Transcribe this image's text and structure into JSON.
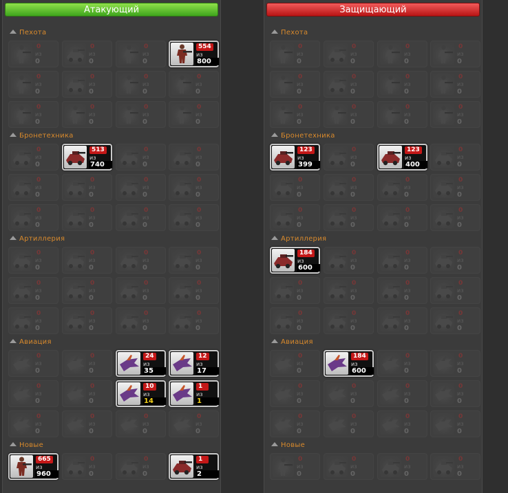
{
  "colors": {
    "attacker": "#3fa51d",
    "defender": "#b81515",
    "section": "#d98a2c",
    "count_badge": "#c41818"
  },
  "sides": [
    {
      "id": "left",
      "title": "Атакующий",
      "theme": "green",
      "sections": [
        {
          "name": "Пехота",
          "cells": [
            {
              "kind": "infantry",
              "count": "0",
              "total": "0"
            },
            {
              "kind": "vehicle",
              "count": "0",
              "total": "0"
            },
            {
              "kind": "infantry",
              "count": "0",
              "total": "0"
            },
            {
              "kind": "infantry",
              "count": "554",
              "total": "800",
              "active": true
            },
            {
              "kind": "infantry",
              "count": "0",
              "total": "0"
            },
            {
              "kind": "vehicle",
              "count": "0",
              "total": "0"
            },
            {
              "kind": "infantry",
              "count": "0",
              "total": "0"
            },
            {
              "kind": "infantry",
              "count": "0",
              "total": "0"
            },
            {
              "kind": "infantry",
              "count": "0",
              "total": "0"
            },
            {
              "kind": "infantry",
              "count": "0",
              "total": "0"
            },
            {
              "kind": "infantry",
              "count": "0",
              "total": "0"
            },
            {
              "kind": "infantry",
              "count": "0",
              "total": "0"
            }
          ]
        },
        {
          "name": "Бронетехника",
          "cells": [
            {
              "kind": "vehicle",
              "count": "0",
              "total": "0"
            },
            {
              "kind": "vehicle",
              "count": "513",
              "total": "740",
              "active": true
            },
            {
              "kind": "vehicle",
              "count": "0",
              "total": "0"
            },
            {
              "kind": "vehicle",
              "count": "0",
              "total": "0"
            },
            {
              "kind": "vehicle",
              "count": "0",
              "total": "0"
            },
            {
              "kind": "vehicle",
              "count": "0",
              "total": "0"
            },
            {
              "kind": "vehicle",
              "count": "0",
              "total": "0"
            },
            {
              "kind": "vehicle",
              "count": "0",
              "total": "0"
            },
            {
              "kind": "vehicle",
              "count": "0",
              "total": "0"
            },
            {
              "kind": "vehicle",
              "count": "0",
              "total": "0"
            },
            {
              "kind": "vehicle",
              "count": "0",
              "total": "0"
            },
            {
              "kind": "vehicle",
              "count": "0",
              "total": "0"
            }
          ]
        },
        {
          "name": "Артиллерия",
          "cells": [
            {
              "kind": "vehicle",
              "count": "0",
              "total": "0"
            },
            {
              "kind": "vehicle",
              "count": "0",
              "total": "0"
            },
            {
              "kind": "vehicle",
              "count": "0",
              "total": "0"
            },
            {
              "kind": "vehicle",
              "count": "0",
              "total": "0"
            },
            {
              "kind": "vehicle",
              "count": "0",
              "total": "0"
            },
            {
              "kind": "vehicle",
              "count": "0",
              "total": "0"
            },
            {
              "kind": "vehicle",
              "count": "0",
              "total": "0"
            },
            {
              "kind": "vehicle",
              "count": "0",
              "total": "0"
            },
            {
              "kind": "vehicle",
              "count": "0",
              "total": "0"
            },
            {
              "kind": "vehicle",
              "count": "0",
              "total": "0"
            },
            {
              "kind": "vehicle",
              "count": "0",
              "total": "0"
            },
            {
              "kind": "vehicle",
              "count": "0",
              "total": "0"
            }
          ]
        },
        {
          "name": "Авиация",
          "cells": [
            {
              "kind": "air",
              "count": "0",
              "total": "0"
            },
            {
              "kind": "air",
              "count": "0",
              "total": "0"
            },
            {
              "kind": "air",
              "count": "24",
              "total": "35",
              "active": true
            },
            {
              "kind": "air",
              "count": "12",
              "total": "17",
              "active": true
            },
            {
              "kind": "air",
              "count": "0",
              "total": "0"
            },
            {
              "kind": "air",
              "count": "0",
              "total": "0"
            },
            {
              "kind": "air",
              "count": "10",
              "total": "14",
              "active": true,
              "highlight": true
            },
            {
              "kind": "air",
              "count": "1",
              "total": "1",
              "active": true,
              "highlight": true
            },
            {
              "kind": "air",
              "count": "0",
              "total": "0"
            },
            {
              "kind": "air",
              "count": "0",
              "total": "0"
            },
            {
              "kind": "air",
              "count": "0",
              "total": "0"
            },
            {
              "kind": "air",
              "count": "0",
              "total": "0"
            }
          ]
        },
        {
          "name": "Новые",
          "cells": [
            {
              "kind": "infantry",
              "count": "665",
              "total": "960",
              "active": true
            },
            {
              "kind": "vehicle",
              "count": "0",
              "total": "0"
            },
            {
              "kind": "vehicle",
              "count": "0",
              "total": "0"
            },
            {
              "kind": "vehicle",
              "count": "1",
              "total": "2",
              "active": true
            }
          ]
        }
      ]
    },
    {
      "id": "right",
      "title": "Защищающий",
      "theme": "red",
      "sections": [
        {
          "name": "Пехота",
          "cells": [
            {
              "kind": "infantry",
              "count": "0",
              "total": "0"
            },
            {
              "kind": "vehicle",
              "count": "0",
              "total": "0"
            },
            {
              "kind": "infantry",
              "count": "0",
              "total": "0"
            },
            {
              "kind": "infantry",
              "count": "0",
              "total": "0"
            },
            {
              "kind": "infantry",
              "count": "0",
              "total": "0"
            },
            {
              "kind": "vehicle",
              "count": "0",
              "total": "0"
            },
            {
              "kind": "infantry",
              "count": "0",
              "total": "0"
            },
            {
              "kind": "infantry",
              "count": "0",
              "total": "0"
            },
            {
              "kind": "infantry",
              "count": "0",
              "total": "0"
            },
            {
              "kind": "infantry",
              "count": "0",
              "total": "0"
            },
            {
              "kind": "infantry",
              "count": "0",
              "total": "0"
            },
            {
              "kind": "infantry",
              "count": "0",
              "total": "0"
            }
          ]
        },
        {
          "name": "Бронетехника",
          "cells": [
            {
              "kind": "vehicle",
              "count": "123",
              "total": "399",
              "active": true
            },
            {
              "kind": "vehicle",
              "count": "0",
              "total": "0"
            },
            {
              "kind": "vehicle",
              "count": "123",
              "total": "400",
              "active": true
            },
            {
              "kind": "vehicle",
              "count": "0",
              "total": "0"
            },
            {
              "kind": "vehicle",
              "count": "0",
              "total": "0"
            },
            {
              "kind": "vehicle",
              "count": "0",
              "total": "0"
            },
            {
              "kind": "vehicle",
              "count": "0",
              "total": "0"
            },
            {
              "kind": "vehicle",
              "count": "0",
              "total": "0"
            },
            {
              "kind": "vehicle",
              "count": "0",
              "total": "0"
            },
            {
              "kind": "vehicle",
              "count": "0",
              "total": "0"
            },
            {
              "kind": "vehicle",
              "count": "0",
              "total": "0"
            },
            {
              "kind": "vehicle",
              "count": "0",
              "total": "0"
            }
          ]
        },
        {
          "name": "Артиллерия",
          "cells": [
            {
              "kind": "vehicle",
              "count": "184",
              "total": "600",
              "active": true
            },
            {
              "kind": "vehicle",
              "count": "0",
              "total": "0"
            },
            {
              "kind": "vehicle",
              "count": "0",
              "total": "0"
            },
            {
              "kind": "vehicle",
              "count": "0",
              "total": "0"
            },
            {
              "kind": "vehicle",
              "count": "0",
              "total": "0"
            },
            {
              "kind": "vehicle",
              "count": "0",
              "total": "0"
            },
            {
              "kind": "vehicle",
              "count": "0",
              "total": "0"
            },
            {
              "kind": "vehicle",
              "count": "0",
              "total": "0"
            },
            {
              "kind": "vehicle",
              "count": "0",
              "total": "0"
            },
            {
              "kind": "vehicle",
              "count": "0",
              "total": "0"
            },
            {
              "kind": "vehicle",
              "count": "0",
              "total": "0"
            },
            {
              "kind": "vehicle",
              "count": "0",
              "total": "0"
            }
          ]
        },
        {
          "name": "Авиация",
          "cells": [
            {
              "kind": "air",
              "count": "0",
              "total": "0"
            },
            {
              "kind": "air",
              "count": "184",
              "total": "600",
              "active": true
            },
            {
              "kind": "air",
              "count": "0",
              "total": "0"
            },
            {
              "kind": "air",
              "count": "0",
              "total": "0"
            },
            {
              "kind": "air",
              "count": "0",
              "total": "0"
            },
            {
              "kind": "air",
              "count": "0",
              "total": "0"
            },
            {
              "kind": "air",
              "count": "0",
              "total": "0"
            },
            {
              "kind": "air",
              "count": "0",
              "total": "0"
            },
            {
              "kind": "air",
              "count": "0",
              "total": "0"
            },
            {
              "kind": "air",
              "count": "0",
              "total": "0"
            },
            {
              "kind": "air",
              "count": "0",
              "total": "0"
            },
            {
              "kind": "air",
              "count": "0",
              "total": "0"
            }
          ]
        },
        {
          "name": "Новые",
          "cells": [
            {
              "kind": "infantry",
              "count": "0",
              "total": "0"
            },
            {
              "kind": "vehicle",
              "count": "0",
              "total": "0"
            },
            {
              "kind": "vehicle",
              "count": "0",
              "total": "0"
            },
            {
              "kind": "vehicle",
              "count": "0",
              "total": "0"
            }
          ]
        }
      ]
    }
  ],
  "of_label": "из"
}
